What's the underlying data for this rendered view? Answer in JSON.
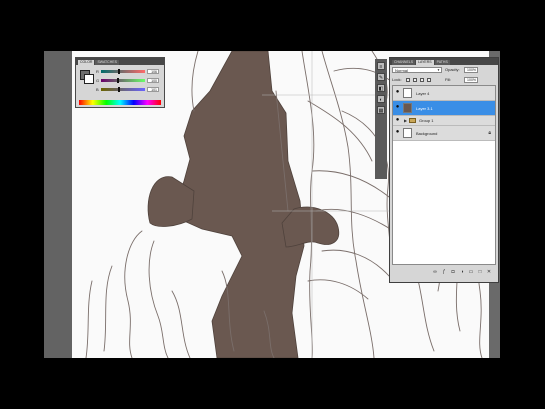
{
  "colors": {
    "selection": "#3a8ee6",
    "panel_bg": "#d6d6d6",
    "tab_bar": "#474747",
    "shading": "#6a5850",
    "sketch_line": "#7a6e6a",
    "foreground_swatch": "#6e6e6e",
    "background_swatch": "#ffffff"
  },
  "color_panel": {
    "tabs": [
      "COLOR",
      "SWATCHES"
    ],
    "active_tab": 0,
    "channels": [
      {
        "label": "R",
        "value": "106",
        "level": 0.42,
        "gradient": [
          "#006a6a",
          "#ff6a6a"
        ]
      },
      {
        "label": "G",
        "value": "100",
        "level": 0.39,
        "gradient": [
          "#6a006a",
          "#6aff6a"
        ]
      },
      {
        "label": "B",
        "value": "101",
        "level": 0.4,
        "gradient": [
          "#6a6400",
          "#6a64ff"
        ]
      }
    ],
    "foreground_icon": "foreground-color-swatch",
    "background_icon": "background-color-swatch",
    "spectrum_icon": "color-spectrum-bar"
  },
  "tools": {
    "items": [
      {
        "icon": "history-icon",
        "glyph": "≡"
      },
      {
        "icon": "brush-icon",
        "glyph": "✎"
      },
      {
        "icon": "layers-icon",
        "glyph": "◧"
      },
      {
        "icon": "adjust-icon",
        "glyph": "◐"
      },
      {
        "icon": "channels-icon",
        "glyph": "▦"
      }
    ]
  },
  "layers_panel": {
    "tabs": [
      "CHANNELS",
      "LAYERS",
      "PATHS"
    ],
    "active_tab": 1,
    "blend_mode": "Normal",
    "opacity_label": "Opacity:",
    "opacity_value": "100%",
    "lock_label": "Lock:",
    "fill_label": "Fill:",
    "fill_value": "100%",
    "layers": [
      {
        "name": "Layer 4",
        "visible": true,
        "selected": false,
        "kind": "layer",
        "thumb_icon": "layer-thumbnail",
        "locked": false
      },
      {
        "name": "Layer 3.1",
        "visible": true,
        "selected": true,
        "kind": "layer",
        "thumb_icon": "layer-thumbnail",
        "locked": false
      },
      {
        "name": "Group 1",
        "visible": true,
        "selected": false,
        "kind": "group",
        "thumb_icon": "folder-icon",
        "locked": false
      },
      {
        "name": "Background",
        "visible": true,
        "selected": false,
        "kind": "layer",
        "thumb_icon": "layer-thumbnail",
        "locked": true
      }
    ],
    "footer_icons": [
      {
        "icon": "link-icon",
        "glyph": "∞"
      },
      {
        "icon": "fx-icon",
        "glyph": "ƒ"
      },
      {
        "icon": "mask-icon",
        "glyph": "◘"
      },
      {
        "icon": "adjustment-layer-icon",
        "glyph": "◑"
      },
      {
        "icon": "new-group-icon",
        "glyph": "▭"
      },
      {
        "icon": "new-layer-icon",
        "glyph": "□"
      },
      {
        "icon": "trash-icon",
        "glyph": "✕"
      }
    ]
  }
}
